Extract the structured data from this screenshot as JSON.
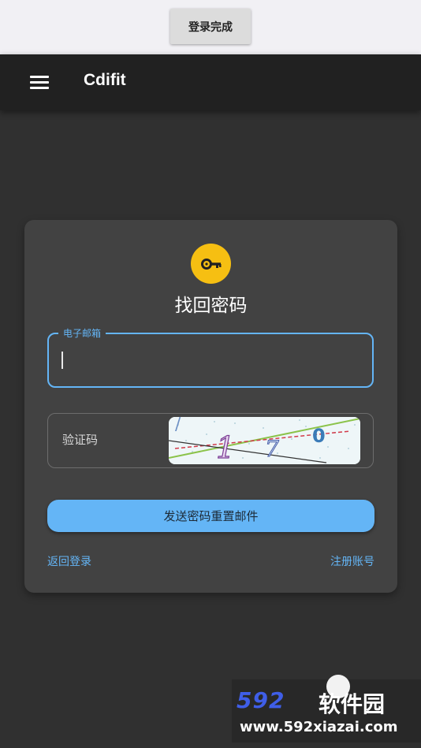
{
  "top_banner": {
    "button_label": "登录完成"
  },
  "app_bar": {
    "title": "Cdifit",
    "menu_icon": "menu-icon"
  },
  "card": {
    "icon": "key-icon",
    "title": "找回密码",
    "email_field": {
      "label": "电子邮箱",
      "value": ""
    },
    "captcha_field": {
      "label": "验证码",
      "captcha_text": "1 7 0"
    },
    "send_button_label": "发送密码重置邮件",
    "back_link": "返回登录",
    "register_link": "注册账号"
  },
  "watermark": {
    "logo": "592",
    "logo_cn": "软件园",
    "url": "www.592xiazai.com"
  },
  "colors": {
    "accent": "#64b5f6",
    "badge": "#f6bf12",
    "background": "#303030",
    "card": "#424242",
    "app_bar": "#212121"
  }
}
